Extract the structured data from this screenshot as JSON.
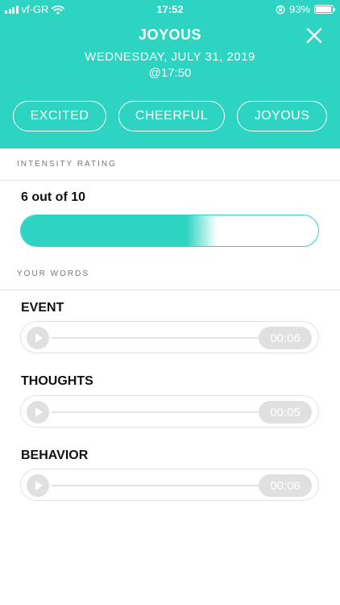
{
  "status": {
    "carrier": "vf-GR",
    "time": "17:52",
    "battery": "93%",
    "battery_level": 0.93
  },
  "header": {
    "title": "JOYOUS",
    "date": "WEDNESDAY, JULY 31, 2019",
    "time": "@17:50",
    "chips": [
      "EXCITED",
      "CHEERFUL",
      "JOYOUS"
    ]
  },
  "intensity": {
    "label": "INTENSITY RATING",
    "value_text": "6 out of 10",
    "value": 6,
    "max": 10
  },
  "words": {
    "label": "YOUR WORDS",
    "items": [
      {
        "title": "EVENT",
        "duration": "00:06"
      },
      {
        "title": "THOUGHTS",
        "duration": "00:05"
      },
      {
        "title": "BEHAVIOR",
        "duration": "00:06"
      }
    ]
  },
  "colors": {
    "accent": "#2dd4c1",
    "pill_grey": "#e0e0e0"
  }
}
